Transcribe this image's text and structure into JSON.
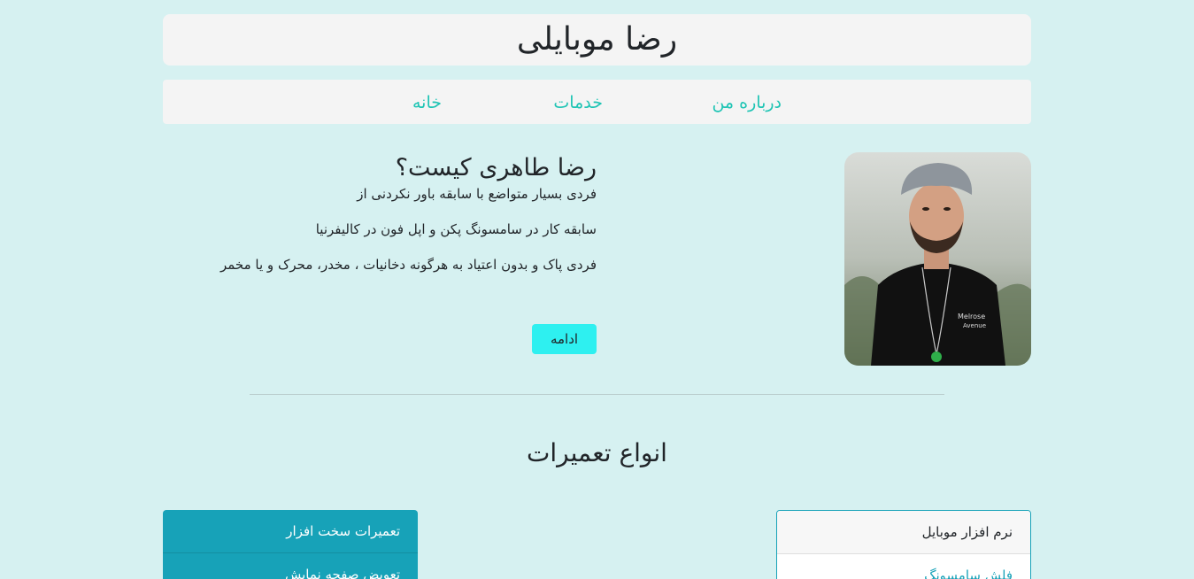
{
  "header": {
    "title": "رضا موبایلی"
  },
  "nav": {
    "items": [
      {
        "label": "درباره من"
      },
      {
        "label": "خدمات"
      },
      {
        "label": "خانه"
      }
    ]
  },
  "about": {
    "heading": "رضا طاهری کیست؟",
    "lines": [
      "فردی بسیار متواضع با سابقه باور نکردنی از",
      "سابقه کار در سامسونگ پکن و اپل فون در کالیفرنیا",
      "فردی پاک و بدون اعتیاد به هرگونه دخانیات ، مخدر، محرک و یا مخمر"
    ],
    "button_label": "ادامه"
  },
  "services": {
    "title": "انواع تعمیرات",
    "software_card": {
      "header": "نرم افزار موبایل",
      "first_item": "فلش سامسونگ"
    },
    "hardware_card": {
      "header": "تعمیرات سخت افزار",
      "first_item": "تعویض صفحه نمایش"
    }
  },
  "colors": {
    "background": "#d6f1f1",
    "accent": "#1ec4b4",
    "button": "#2ef0f0",
    "card": "#17a2b8"
  }
}
